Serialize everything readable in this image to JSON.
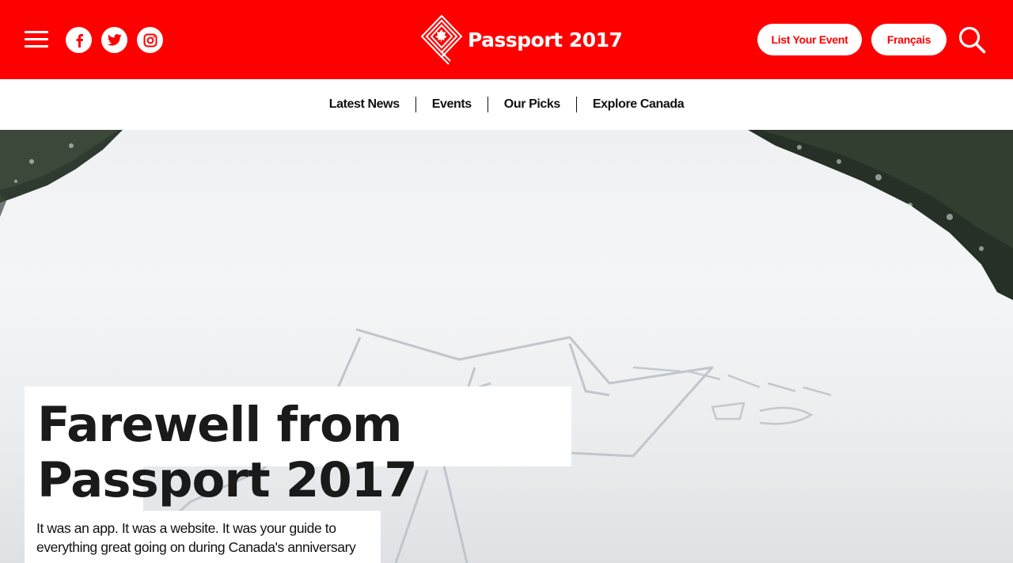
{
  "header": {
    "logo_text": "Passport 2017",
    "list_event_label": "List Your Event",
    "language_label": "Français",
    "brand_color": "#ff0000"
  },
  "social": {
    "facebook_icon": "facebook-icon",
    "twitter_icon": "twitter-icon",
    "instagram_icon": "instagram-icon"
  },
  "nav": {
    "items": [
      "Latest News",
      "Events",
      "Our Picks",
      "Explore Canada"
    ]
  },
  "hero": {
    "title": "Farewell from Passport 2017",
    "summary": "It was an app. It was a website. It was your guide to everything great going on during Canada's anniversary year.",
    "image_description_icon": "snow-field-image"
  }
}
